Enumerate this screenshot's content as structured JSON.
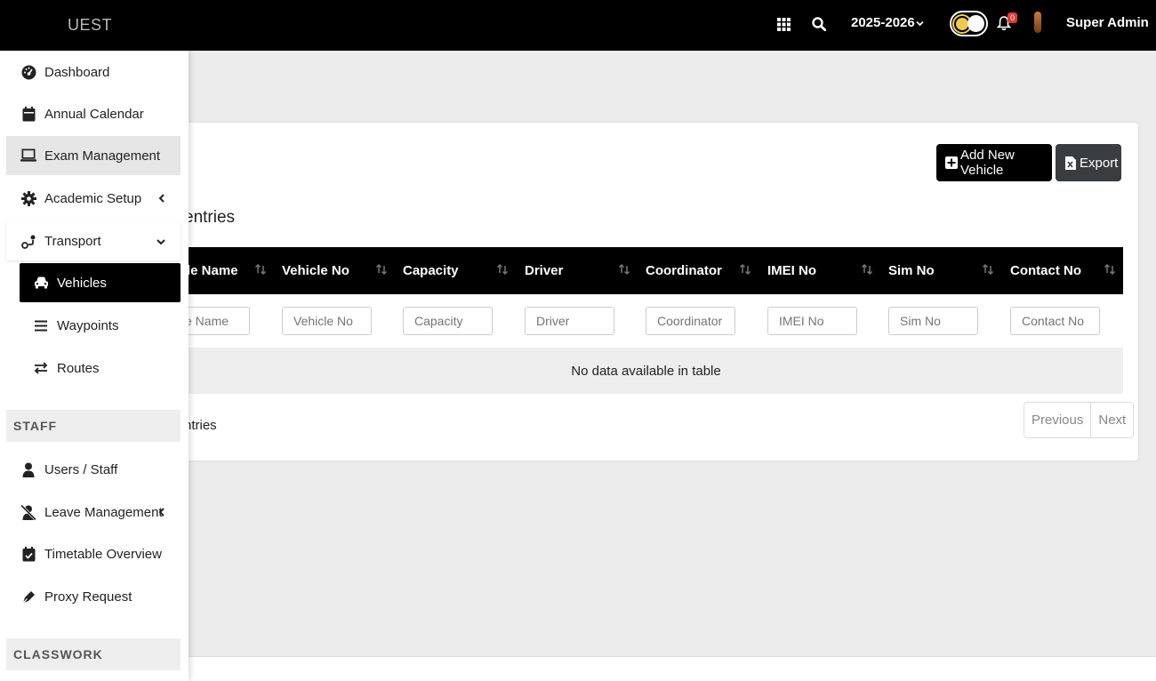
{
  "app": {
    "brand": "UEST"
  },
  "topbar": {
    "year": "2025-2026",
    "notification_count": "0",
    "user_name": "Super Admin"
  },
  "sidebar": {
    "items": [
      {
        "label": "Dashboard",
        "icon": "gauge-icon"
      },
      {
        "label": "Annual Calendar",
        "icon": "calendar-icon"
      },
      {
        "label": "Exam Management",
        "icon": "laptop-icon"
      },
      {
        "label": "Academic Setup",
        "icon": "gear-icon"
      },
      {
        "label": "Transport",
        "icon": "route-icon"
      }
    ],
    "transport_sub": [
      {
        "label": "Vehicles",
        "icon": "car-icon"
      },
      {
        "label": "Waypoints",
        "icon": "list-icon"
      },
      {
        "label": "Routes",
        "icon": "exchange-icon"
      }
    ],
    "staff_header": "STAFF",
    "staff_items": [
      {
        "label": "Users / Staff",
        "icon": "user-icon"
      },
      {
        "label": "Leave Management",
        "icon": "user-slash-icon"
      },
      {
        "label": "Timetable Overview",
        "icon": "calendar-check-icon"
      },
      {
        "label": "Proxy Request",
        "icon": "pen-icon"
      }
    ],
    "classwork_header": "CLASSWORK"
  },
  "main": {
    "add_button": "Add New Vehicle",
    "export_button": "Export",
    "entries_top": "entries",
    "columns": [
      "le Name",
      "Vehicle No",
      "Capacity",
      "Driver",
      "Coordinator",
      "IMEI No",
      "Sim No",
      "Contact No"
    ],
    "filters": [
      "hicle Name",
      "Vehicle No",
      "Capacity",
      "Driver",
      "Coordinator",
      "IMEI No",
      "Sim No",
      "Contact No"
    ],
    "empty_message": "No data available in table",
    "entries_bottom": "ntries",
    "prev": "Previous",
    "next": "Next"
  },
  "colors": {
    "topbar": "#000000",
    "active": "#000000",
    "export": "#3a3d40",
    "badge": "#e53935"
  }
}
